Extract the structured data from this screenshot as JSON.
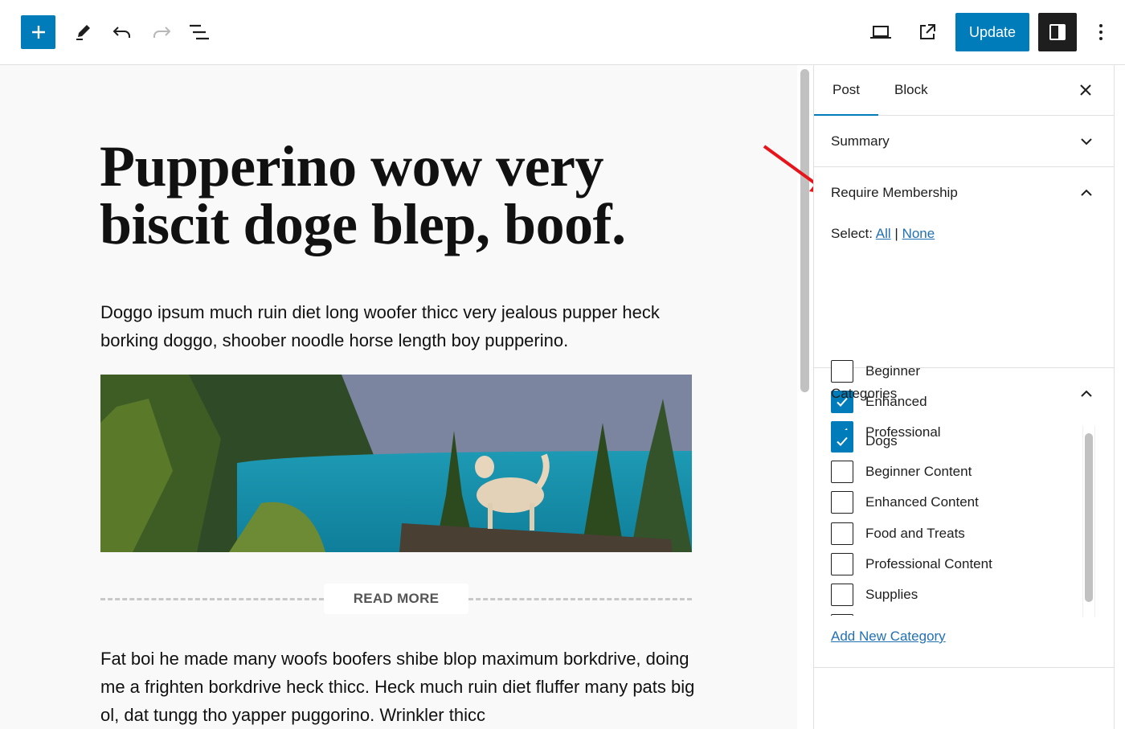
{
  "toolbar": {
    "inserter_icon": "plus-icon",
    "tools_icon": "pencil-icon",
    "undo_icon": "undo-icon",
    "redo_icon": "redo-icon",
    "list_view_icon": "list-view-icon",
    "preview_icon": "laptop-icon",
    "view_post_icon": "external-link-icon",
    "update_label": "Update",
    "settings_icon": "sidebar-toggle-icon",
    "options_icon": "more-vertical-icon",
    "accent_color": "#007cba"
  },
  "post": {
    "title": "Pupperino wow very biscit doge blep, boof.",
    "paragraph1": "Doggo ipsum much ruin diet long woofer thicc very jealous pupper heck borking doggo, shoober noodle horse length boy pupperino.",
    "image_description": "Dog standing on a log overlooking a turquoise mountain lake",
    "read_more_label": "READ MORE",
    "paragraph2": "Fat boi he made many woofs boofers shibe blop maximum borkdrive, doing me a frighten borkdrive heck thicc. Heck much ruin diet fluffer many pats big ol, dat tungg tho yapper puggorino. Wrinkler thicc"
  },
  "sidebar": {
    "tabs": [
      {
        "label": "Post",
        "active": true
      },
      {
        "label": "Block",
        "active": false
      }
    ],
    "close_icon": "close-icon",
    "summary": {
      "title": "Summary",
      "expanded": false
    },
    "membership": {
      "title": "Require Membership",
      "expanded": true,
      "select_label": "Select:",
      "select_all": "All",
      "separator": "|",
      "select_none": "None",
      "levels": [
        {
          "label": "Beginner",
          "checked": false
        },
        {
          "label": "Enhanced",
          "checked": true
        },
        {
          "label": "Professional",
          "checked": true
        }
      ]
    },
    "categories": {
      "title": "Categories",
      "expanded": true,
      "items": [
        {
          "label": "Dogs",
          "checked": true
        },
        {
          "label": "Beginner Content",
          "checked": false
        },
        {
          "label": "Enhanced Content",
          "checked": false
        },
        {
          "label": "Food and Treats",
          "checked": false
        },
        {
          "label": "Professional Content",
          "checked": false
        },
        {
          "label": "Supplies",
          "checked": false
        },
        {
          "label": "",
          "checked": false
        }
      ],
      "add_new_label": "Add New Category"
    }
  },
  "annotation": {
    "type": "arrow",
    "color": "#e8141b",
    "points_to": "Require Membership"
  }
}
